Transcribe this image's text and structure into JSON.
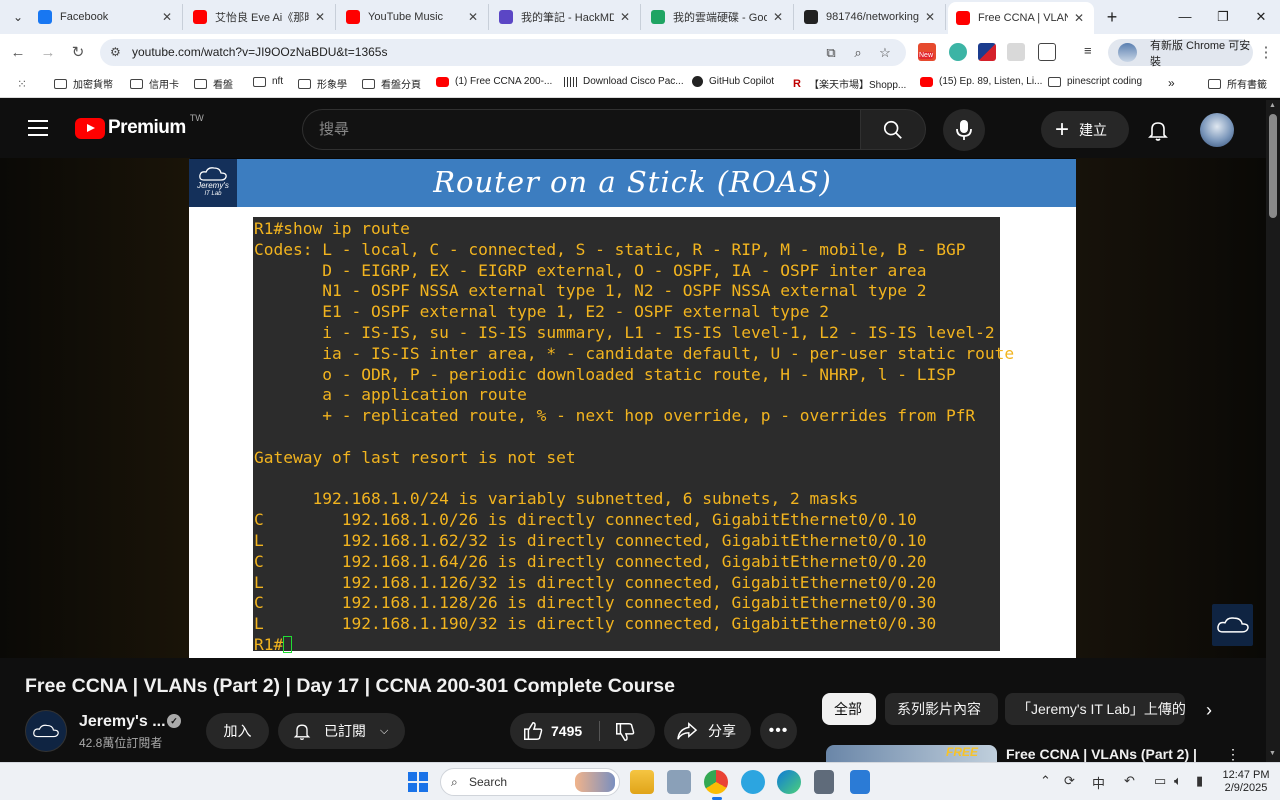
{
  "browser": {
    "tabs": [
      {
        "title": "Facebook",
        "icon": "facebook-icon",
        "color": "#1877f2"
      },
      {
        "title": "艾怡良 Eve Ai《那時",
        "icon": "youtube-icon",
        "color": "#ff0000"
      },
      {
        "title": "YouTube Music",
        "icon": "youtube-music-icon",
        "color": "#ff0000"
      },
      {
        "title": "我的筆記 - HackMD",
        "icon": "hackmd-icon",
        "color": "#5b46c5"
      },
      {
        "title": "我的雲端硬碟 - Goog",
        "icon": "google-drive-icon",
        "color": "#1fa463"
      },
      {
        "title": "981746/networking-",
        "icon": "github-icon",
        "color": "#222222"
      },
      {
        "title": "Free CCNA | VLAN",
        "icon": "youtube-icon",
        "color": "#ff0000"
      }
    ],
    "url": "youtube.com/watch?v=JI9OOzNaBDU&t=1365s",
    "update_button": "有新版 Chrome 可安裝",
    "ext_badge": "New",
    "bookmarks": [
      {
        "label": "加密貨幣",
        "icon": "folder-icon"
      },
      {
        "label": "信用卡",
        "icon": "folder-icon"
      },
      {
        "label": "看盤",
        "icon": "folder-icon"
      },
      {
        "label": "nft",
        "icon": "folder-icon"
      },
      {
        "label": "形象學",
        "icon": "folder-icon"
      },
      {
        "label": "看盤分頁",
        "icon": "folder-icon"
      },
      {
        "label": "(1) Free CCNA 200-...",
        "icon": "youtube-icon"
      },
      {
        "label": "Download Cisco Pac...",
        "icon": "cisco-icon"
      },
      {
        "label": "GitHub Copilot",
        "icon": "github-icon"
      },
      {
        "label": "【楽天市場】Shopp...",
        "icon": "rakuten-icon"
      },
      {
        "label": "(15) Ep. 89, Listen, Li...",
        "icon": "youtube-icon"
      },
      {
        "label": "pinescript coding",
        "icon": "folder-icon"
      },
      {
        "label": "所有書籤",
        "icon": "folder-icon"
      }
    ]
  },
  "youtube": {
    "logo_text": "Premium",
    "region": "TW",
    "search_placeholder": "搜尋",
    "create_label": "建立"
  },
  "video": {
    "slide_logo_line1": "Jeremy's",
    "slide_logo_line2": "IT Lab",
    "slide_title": "Router on a Stick (ROAS)",
    "terminal_lines": [
      "R1#show ip route",
      "Codes: L - local, C - connected, S - static, R - RIP, M - mobile, B - BGP",
      "       D - EIGRP, EX - EIGRP external, O - OSPF, IA - OSPF inter area",
      "       N1 - OSPF NSSA external type 1, N2 - OSPF NSSA external type 2",
      "       E1 - OSPF external type 1, E2 - OSPF external type 2",
      "       i - IS-IS, su - IS-IS summary, L1 - IS-IS level-1, L2 - IS-IS level-2",
      "       ia - IS-IS inter area, * - candidate default, U - per-user static route",
      "       o - ODR, P - periodic downloaded static route, H - NHRP, l - LISP",
      "       a - application route",
      "       + - replicated route, % - next hop override, p - overrides from PfR",
      "",
      "Gateway of last resort is not set",
      "",
      "      192.168.1.0/24 is variably subnetted, 6 subnets, 2 masks",
      "C        192.168.1.0/26 is directly connected, GigabitEthernet0/0.10",
      "L        192.168.1.62/32 is directly connected, GigabitEthernet0/0.10",
      "C        192.168.1.64/26 is directly connected, GigabitEthernet0/0.20",
      "L        192.168.1.126/32 is directly connected, GigabitEthernet0/0.20",
      "C        192.168.1.128/26 is directly connected, GigabitEthernet0/0.30",
      "L        192.168.1.190/32 is directly connected, GigabitEthernet0/0.30"
    ],
    "prompt": "R1#",
    "title": "Free CCNA | VLANs (Part 2) | Day 17 | CCNA 200-301 Complete Course",
    "channel": "Jeremy's ...",
    "subscribers": "42.8萬位訂閱者",
    "join_label": "加入",
    "subscribed_label": "已訂閱",
    "likes": "7495",
    "share_label": "分享"
  },
  "sidebar": {
    "chips": [
      "全部",
      "系列影片內容",
      "「Jeremy's IT Lab」上傳的"
    ],
    "rec_title": "Free CCNA | VLANs (Part 2) |",
    "rec_thumb_text": "FREE"
  },
  "taskbar": {
    "search_label": "Search",
    "ime": "中",
    "time": "12:47 PM",
    "date": "2/9/2025"
  }
}
